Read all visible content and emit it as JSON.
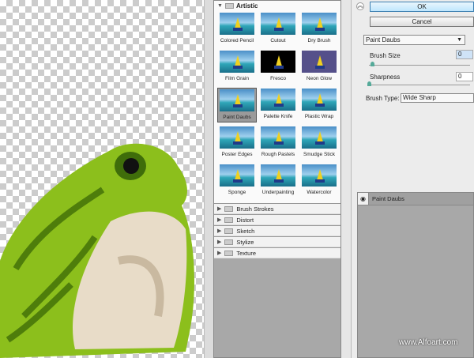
{
  "filter_gallery": {
    "open_category": "Artistic",
    "thumbnails": [
      "Colored Pencil",
      "Cutout",
      "Dry Brush",
      "Film Grain",
      "Fresco",
      "Neon Glow",
      "Paint Daubs",
      "Palette Knife",
      "Plastic Wrap",
      "Poster Edges",
      "Rough Pastels",
      "Smudge Stick",
      "Sponge",
      "Underpainting",
      "Watercolor"
    ],
    "selected": "Paint Daubs",
    "categories": [
      "Brush Strokes",
      "Distort",
      "Sketch",
      "Stylize",
      "Texture"
    ]
  },
  "settings": {
    "collapse_icon": "double-chevron-up-icon",
    "ok_label": "OK",
    "cancel_label": "Cancel",
    "filter_select": "Paint Daubs",
    "brush_size_label": "Brush Size",
    "brush_size_value": "0",
    "sharpness_label": "Sharpness",
    "sharpness_value": "0",
    "brush_type_label": "Brush Type:",
    "brush_type_value": "Wide Sharp"
  },
  "effect_layers": [
    {
      "name": "Paint Daubs",
      "visible": true
    }
  ],
  "watermark": "www.Alfoart.com"
}
